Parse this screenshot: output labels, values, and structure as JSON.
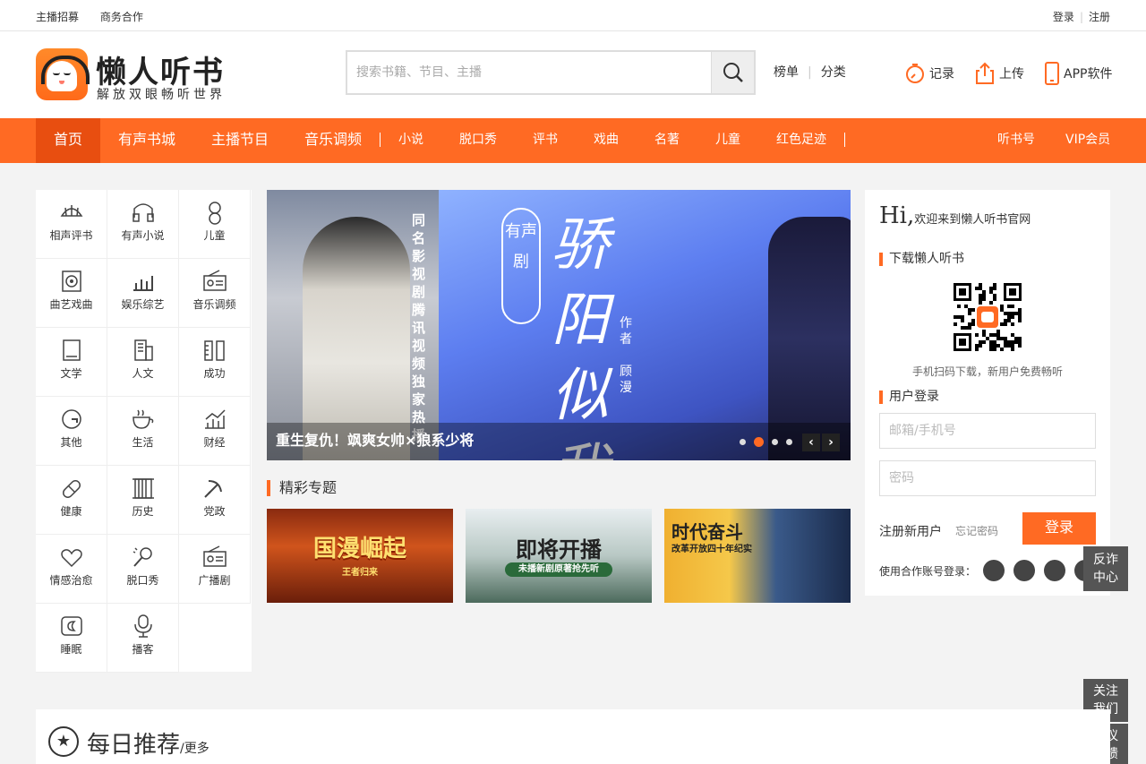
{
  "topbar": {
    "left": [
      "主播招募",
      "商务合作"
    ],
    "login": "登录",
    "register": "注册"
  },
  "brand": {
    "title": "懒人听书",
    "subtitle": "解放双眼畅听世界",
    "accent": "#ff6a23"
  },
  "search": {
    "placeholder": "搜索书籍、节目、主播",
    "icon": "search-icon"
  },
  "header_links": [
    "榜单",
    "分类"
  ],
  "header_actions": [
    {
      "label": "记录",
      "icon": "clock-icon"
    },
    {
      "label": "上传",
      "icon": "upload-icon"
    },
    {
      "label": "APP软件",
      "icon": "phone-icon"
    }
  ],
  "nav": {
    "main": [
      "首页",
      "有声书城",
      "主播节目",
      "音乐调频"
    ],
    "sub": [
      "小说",
      "脱口秀",
      "评书",
      "戏曲",
      "名著",
      "儿童",
      "红色足迹"
    ],
    "right": [
      "听书号",
      "VIP会员"
    ]
  },
  "categories": [
    {
      "label": "相声评书",
      "icon": "fan-icon"
    },
    {
      "label": "有声小说",
      "icon": "headphones-icon"
    },
    {
      "label": "儿童",
      "icon": "child-icon"
    },
    {
      "label": "曲艺戏曲",
      "icon": "speaker-icon"
    },
    {
      "label": "娱乐综艺",
      "icon": "chart-icon"
    },
    {
      "label": "音乐调频",
      "icon": "radio-icon"
    },
    {
      "label": "文学",
      "icon": "book-icon"
    },
    {
      "label": "人文",
      "icon": "building-icon"
    },
    {
      "label": "成功",
      "icon": "ruler-icon"
    },
    {
      "label": "其他",
      "icon": "circle-g-icon"
    },
    {
      "label": "生活",
      "icon": "cup-icon"
    },
    {
      "label": "财经",
      "icon": "bar-chart-icon"
    },
    {
      "label": "健康",
      "icon": "pill-icon"
    },
    {
      "label": "历史",
      "icon": "scroll-icon"
    },
    {
      "label": "党政",
      "icon": "hammer-sickle-icon"
    },
    {
      "label": "情感治愈",
      "icon": "heart-icon"
    },
    {
      "label": "脱口秀",
      "icon": "microphone-icon"
    },
    {
      "label": "广播剧",
      "icon": "radio-icon"
    },
    {
      "label": "睡眠",
      "icon": "moon-icon"
    },
    {
      "label": "播客",
      "icon": "mic-icon"
    }
  ],
  "banner": {
    "left_vertical": "同名影视剧腾讯视频独家热播",
    "badge": "有声剧",
    "title_art": "骄阳似我",
    "author_label": "作者",
    "author": "顾漫",
    "caption": "重生复仇！飒爽女帅×狼系少将",
    "slide_count": 4,
    "active_slide": 2
  },
  "topics": {
    "title": "精彩专题",
    "items": [
      {
        "main": "国漫崛起",
        "sub": "王者归来"
      },
      {
        "main": "即将开播",
        "sub": "未播新剧原著抢先听"
      },
      {
        "main": "时代奋斗",
        "sub": "改革开放四十年纪实"
      }
    ]
  },
  "login": {
    "hi": "Hi,",
    "welcome": "欢迎来到懒人听书官网",
    "download_title": "下载懒人听书",
    "qr_tip": "手机扫码下载，新用户免费畅听",
    "user_login_title": "用户登录",
    "account_placeholder": "邮箱/手机号",
    "password_placeholder": "密码",
    "register": "注册新用户",
    "forgot": "忘记密码",
    "login_button": "登录",
    "coop": "使用合作账号登录："
  },
  "float": {
    "anti_fraud": [
      "反诈",
      "中心"
    ],
    "follow": [
      "关注",
      "我们"
    ],
    "feedback": [
      "建议",
      "反馈"
    ]
  },
  "daily": {
    "title": "每日推荐",
    "more": "/更多"
  }
}
